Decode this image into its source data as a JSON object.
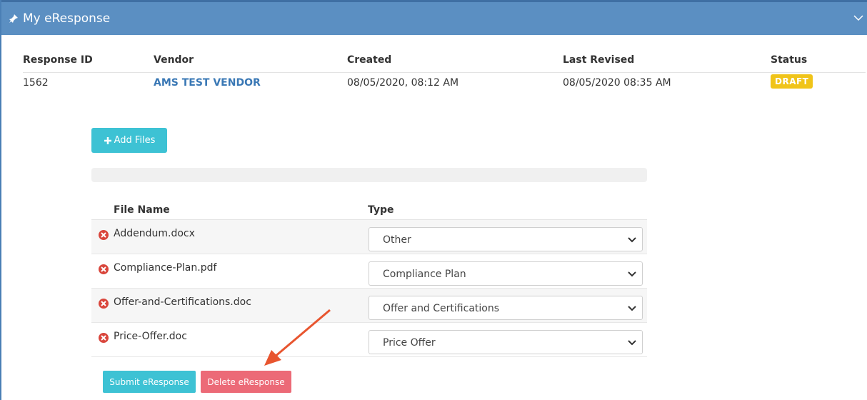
{
  "panel": {
    "title": "My eResponse",
    "header_color": "#5b8fc2"
  },
  "summary": {
    "headers": {
      "response_id": "Response ID",
      "vendor": "Vendor",
      "created": "Created",
      "last_revised": "Last Revised",
      "status": "Status"
    },
    "row": {
      "response_id": "1562",
      "vendor": "AMS TEST VENDOR",
      "created": "08/05/2020, 08:12 AM",
      "last_revised": "08/05/2020 08:35 AM",
      "status": "DRAFT"
    }
  },
  "actions": {
    "add_files": "Add Files",
    "submit": "Submit eResponse",
    "delete": "Delete eResponse"
  },
  "files": {
    "headers": {
      "file_name": "File Name",
      "type": "Type"
    },
    "rows": [
      {
        "name": "Addendum.docx",
        "type": "Other"
      },
      {
        "name": "Compliance-Plan.pdf",
        "type": "Compliance Plan"
      },
      {
        "name": "Offer-and-Certifications.doc",
        "type": "Offer and Certifications"
      },
      {
        "name": "Price-Offer.doc",
        "type": "Price Offer"
      }
    ]
  },
  "icons": {
    "title": "pin-icon",
    "remove": "remove-circle-icon",
    "collapse": "chevron-down-icon",
    "add": "plus-icon",
    "select": "caret-down-icon"
  }
}
